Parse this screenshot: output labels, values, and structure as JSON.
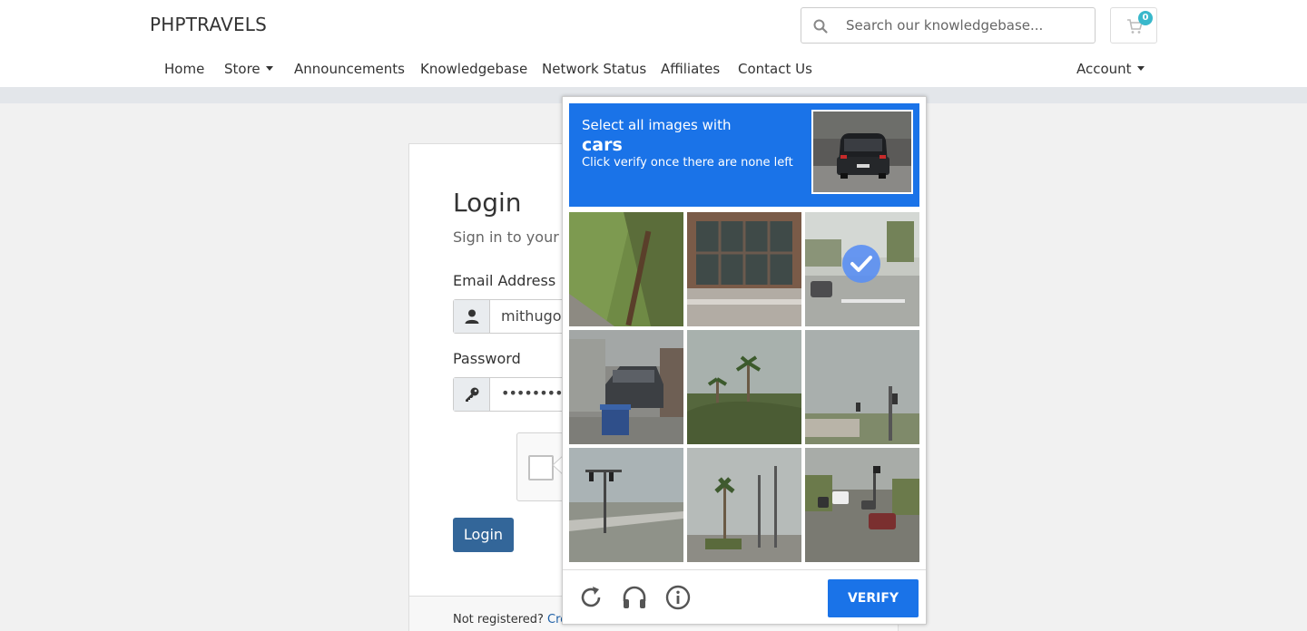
{
  "header": {
    "brand": "PHPTRAVELS",
    "search_placeholder": "Search our knowledgebase...",
    "cart_count": "0"
  },
  "nav": {
    "items": [
      "Home",
      "Store",
      "Announcements",
      "Knowledgebase",
      "Network Status",
      "Affiliates",
      "Contact Us"
    ],
    "account": "Account"
  },
  "login": {
    "title": "Login",
    "subtitle": "Sign in to your a",
    "email_label": "Email Address",
    "email_value": "mithugop",
    "password_label": "Password",
    "password_value": "••••••••••",
    "button": "Login",
    "footer_text": "Not registered?",
    "footer_link": "Crea"
  },
  "captcha": {
    "line1": "Select all images with",
    "target": "cars",
    "line3": "Click verify once there are none left",
    "verify_label": "VERIFY",
    "icons": [
      "reload-icon",
      "audio-icon",
      "info-icon"
    ],
    "selected_tiles": [
      3
    ],
    "accent": "#1a73e8"
  }
}
